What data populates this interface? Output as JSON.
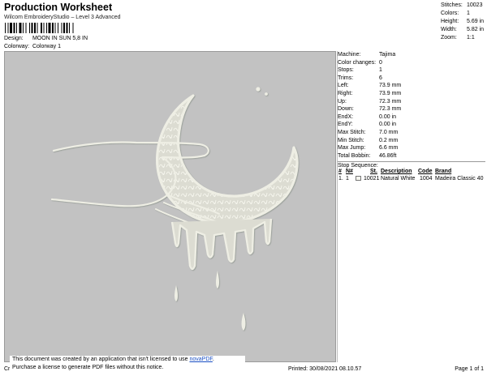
{
  "header": {
    "title": "Production Worksheet",
    "subtitle": "Wilcom EmbroideryStudio – Level 3 Advanced",
    "design_label": "Design:",
    "design_value": "MOON IN SUN 5,8 IN",
    "colorway_label": "Colorway:",
    "colorway_value": "Colorway 1"
  },
  "stats": [
    {
      "label": "Stitches:",
      "value": "10023"
    },
    {
      "label": "Colors:",
      "value": "1"
    },
    {
      "label": "Height:",
      "value": "5.69 in"
    },
    {
      "label": "Width:",
      "value": "5.82 in"
    },
    {
      "label": "Zoom:",
      "value": "1:1"
    }
  ],
  "machine_info": [
    {
      "label": "Machine:",
      "value": "Tajima"
    },
    {
      "label": "Color changes:",
      "value": "0"
    },
    {
      "label": "Stops:",
      "value": "1"
    },
    {
      "label": "Trims:",
      "value": "6"
    },
    {
      "label": "Left:",
      "value": "73.9 mm"
    },
    {
      "label": "Right:",
      "value": "73.9 mm"
    },
    {
      "label": "Up:",
      "value": "72.3 mm"
    },
    {
      "label": "Down:",
      "value": "72.3 mm"
    },
    {
      "label": "EndX:",
      "value": "0.00 in"
    },
    {
      "label": "EndY:",
      "value": "0.00 in"
    },
    {
      "label": "Max Stitch:",
      "value": "7.0 mm"
    },
    {
      "label": "Min Stitch:",
      "value": "0.2 mm"
    },
    {
      "label": "Max Jump:",
      "value": "6.6 mm"
    },
    {
      "label": "Total Bobbin:",
      "value": "46.86ft"
    }
  ],
  "stop_sequence": {
    "title": "Stop Sequence:",
    "columns": [
      "#",
      "N#",
      "St.",
      "Description",
      "Code",
      "Brand"
    ],
    "rows": [
      {
        "num": "1.",
        "n": "1",
        "st": "10021",
        "description": "Natural White",
        "code": "1004",
        "brand": "Madeira Classic 40"
      }
    ]
  },
  "footer": {
    "cr": "Cr",
    "printed": "Printed: 30/08/2021 08.10.57",
    "page": "Page 1 of 1"
  },
  "notice": {
    "line1": "This document was created by an application that isn't licensed to use",
    "link": "novaPDF",
    "line1_end": ".",
    "line2": "Purchase a license to generate PDF files without this notice."
  },
  "colors": {
    "canvas_bg": "#c2c2c2",
    "thread": "#eeeee4",
    "thread_shadow": "#8f968f"
  }
}
